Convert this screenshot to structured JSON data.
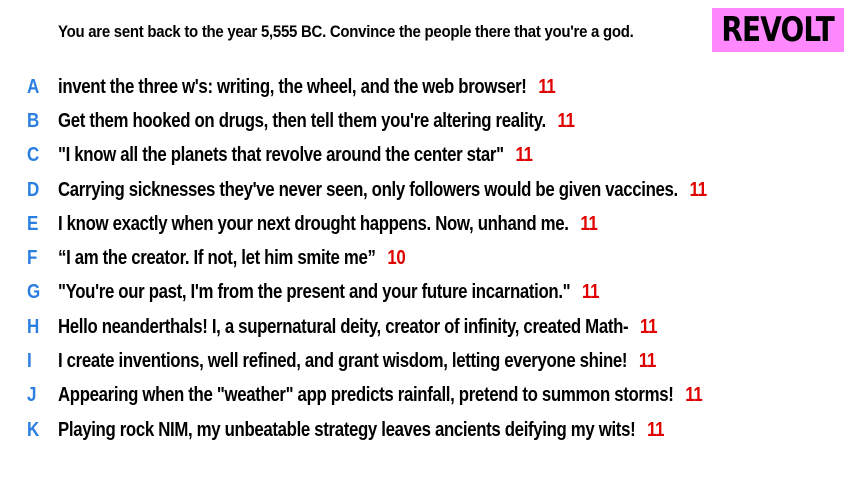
{
  "prompt": "You are sent back to the year 5,555 BC. Convince the people there that you're a god.",
  "logo": {
    "text": "REVOLT",
    "background": "#ff88ff"
  },
  "colors": {
    "letter": "#2a7fe0",
    "score": "#e00000"
  },
  "answers": [
    {
      "letter": "A",
      "text": "invent the three w's: writing, the wheel, and the web browser!",
      "score": "11"
    },
    {
      "letter": "B",
      "text": "Get them hooked on drugs, then tell them you're altering reality.",
      "score": "11"
    },
    {
      "letter": "C",
      "text": "\"I know all the planets that revolve around the center star\"",
      "score": "11"
    },
    {
      "letter": "D",
      "text": "Carrying sicknesses they've never seen, only followers would be given vaccines.",
      "score": "11"
    },
    {
      "letter": "E",
      "text": "I know exactly when your next drought happens. Now, unhand me.",
      "score": "11"
    },
    {
      "letter": "F",
      "text": "“I am the creator. If not, let him smite me”",
      "score": "10"
    },
    {
      "letter": "G",
      "text": "\"You're our past, I'm from the present and your future incarnation.\"",
      "score": "11"
    },
    {
      "letter": "H",
      "text": "Hello neanderthals! I, a supernatural deity, creator of infinity, created Math-",
      "score": "11"
    },
    {
      "letter": "I",
      "text": "I create inventions, well refined, and grant wisdom, letting everyone shine!",
      "score": "11"
    },
    {
      "letter": "J",
      "text": "Appearing when the \"weather\" app predicts rainfall, pretend to summon storms!",
      "score": "11"
    },
    {
      "letter": "K",
      "text": "Playing rock NIM, my unbeatable strategy leaves ancients deifying my wits!",
      "score": "11"
    }
  ]
}
